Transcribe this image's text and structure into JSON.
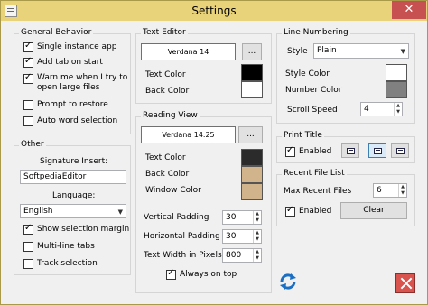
{
  "window": {
    "title": "Settings"
  },
  "general": {
    "label": "General Behavior",
    "items": [
      {
        "label": "Single instance app",
        "checked": true
      },
      {
        "label": "Add tab on start",
        "checked": true
      },
      {
        "label": "Warn me when I try to",
        "label2": "open large files",
        "checked": true
      },
      {
        "label": "Prompt to restore",
        "checked": false
      },
      {
        "label": "Auto word selection",
        "checked": false
      }
    ]
  },
  "other": {
    "label": "Other",
    "signature_label": "Signature Insert:",
    "signature_value": "SoftpediaEditor",
    "language_label": "Language:",
    "language_value": "English",
    "items": [
      {
        "label": "Show selection margin",
        "checked": true
      },
      {
        "label": "Multi-line tabs",
        "checked": false
      },
      {
        "label": "Track selection",
        "checked": false
      }
    ]
  },
  "text_editor": {
    "label": "Text Editor",
    "font": "Verdana 14",
    "browse": "...",
    "text_color_label": "Text Color",
    "back_color_label": "Back Color",
    "text_color": "#000000",
    "back_color": "#ffffff"
  },
  "reading_view": {
    "label": "Reading View",
    "font": "Verdana 14.25",
    "browse": "...",
    "text_color_label": "Text Color",
    "back_color_label": "Back Color",
    "window_color_label": "Window Color",
    "text_color": "#2b2b2b",
    "back_color": "#d2b48c",
    "window_color": "#d2b48c",
    "vpad_label": "Vertical Padding",
    "vpad_value": "30",
    "hpad_label": "Horizontal Padding",
    "hpad_value": "30",
    "width_label": "Text Width in Pixels",
    "width_value": "800",
    "always_on_top": "Always on top"
  },
  "line_numbering": {
    "label": "Line Numbering",
    "style_label": "Style",
    "style_value": "Plain",
    "style_color_label": "Style Color",
    "number_color_label": "Number Color",
    "style_color": "#ffffff",
    "number_color": "#808080",
    "scroll_speed_label": "Scroll Speed",
    "scroll_speed_value": "4"
  },
  "print_title": {
    "label": "Print Title",
    "enabled_label": "Enabled"
  },
  "recent_files": {
    "label": "Recent File List",
    "max_label": "Max Recent Files",
    "max_value": "6",
    "enabled_label": "Enabled",
    "clear_label": "Clear"
  }
}
